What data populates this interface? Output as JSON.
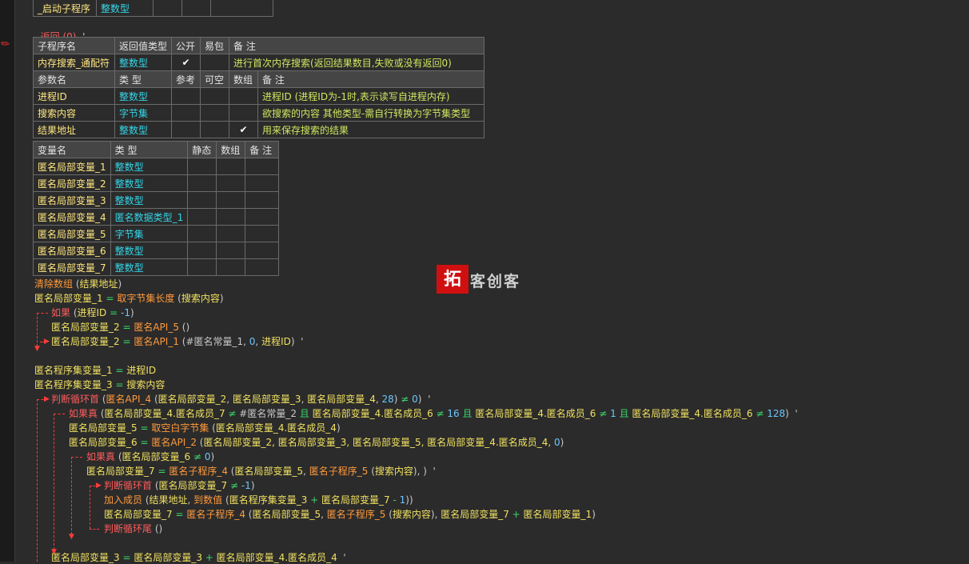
{
  "prev_table": {
    "name": "_启动子程序",
    "type": "整数型"
  },
  "return_line": {
    "text": "返回 (0)",
    "tail": "'"
  },
  "sub_headers": [
    "子程序名",
    "返回值类型",
    "公开",
    "易包",
    "备 注"
  ],
  "sub_row": {
    "name": "内存搜索_通配符",
    "type": "整数型",
    "public": "✔",
    "easy": "",
    "note": "进行首次内存搜索(返回结果数目,失败或没有返回0)"
  },
  "param_headers": [
    "参数名",
    "类 型",
    "参考",
    "可空",
    "数组",
    "备 注"
  ],
  "params": [
    {
      "name": "进程ID",
      "type": "整数型",
      "ref": "",
      "nullable": "",
      "array": "",
      "note": "进程ID (进程ID为-1时,表示读写自进程内存)"
    },
    {
      "name": "搜索内容",
      "type": "字节集",
      "ref": "",
      "nullable": "",
      "array": "",
      "note": "欲搜索的内容  其他类型-需自行转换为字节集类型"
    },
    {
      "name": "结果地址",
      "type": "整数型",
      "ref": "",
      "nullable": "",
      "array": "✔",
      "note": "用来保存搜索的结果"
    }
  ],
  "var_headers": [
    "变量名",
    "类 型",
    "静态",
    "数组",
    "备 注"
  ],
  "vars": [
    {
      "name": "匿名局部变量_1",
      "type": "整数型"
    },
    {
      "name": "匿名局部变量_2",
      "type": "整数型"
    },
    {
      "name": "匿名局部变量_3",
      "type": "整数型"
    },
    {
      "name": "匿名局部变量_4",
      "type": "匿名数据类型_1"
    },
    {
      "name": "匿名局部变量_5",
      "type": "字节集"
    },
    {
      "name": "匿名局部变量_6",
      "type": "整数型"
    },
    {
      "name": "匿名局部变量_7",
      "type": "整数型"
    }
  ],
  "logo": {
    "mark": "拓",
    "text": "客创客"
  },
  "code": {
    "l1": {
      "fn": "清除数组",
      "a": " (",
      "arg": "结果地址",
      "b": ")"
    },
    "l2": {
      "v": "匿名局部变量_1",
      "eq": " = ",
      "fn": "取字节集长度",
      "a": " (",
      "arg": "搜索内容",
      "b": ")"
    },
    "l3": {
      "kw": "如果",
      "a": " (",
      "v": "进程ID",
      "eq": " = ",
      "num": "-1",
      "b": ")"
    },
    "l4": {
      "v": "匿名局部变量_2",
      "eq": " = ",
      "fn": "匿名API_5",
      "b": " ()"
    },
    "l5": {
      "v": "匿名局部变量_2",
      "eq": " = ",
      "fn": "匿名API_1",
      "a": " (#匿名常量_1, ",
      "num": "0",
      "c": ", ",
      "v2": "进程ID",
      "b": ")  ",
      "tk": "'"
    },
    "l6": {
      "v": "匿名程序集变量_1",
      "eq": " = ",
      "v2": "进程ID"
    },
    "l7": {
      "v": "匿名程序集变量_3",
      "eq": " = ",
      "v2": "搜索内容"
    },
    "l8": {
      "kw": "判断循环首",
      "a": " (",
      "fn": "匿名API_4",
      "b": " (",
      "v1": "匿名局部变量_2",
      "c1": ", ",
      "v2": "匿名局部变量_3",
      "c2": ", ",
      "v3": "匿名局部变量_4",
      "c3": ", ",
      "num": "28",
      "d": ") ",
      "op": "≠",
      "num2": " 0",
      "e": ")  ",
      "tk": "'"
    },
    "l9": {
      "kw": "如果真",
      "a": " (",
      "v1": "匿名局部变量_4.匿名成员_7",
      "op1": " ≠ ",
      "c1": "#匿名常量_2",
      "k1": " 且 ",
      "v2": "匿名局部变量_4.匿名成员_6",
      "op2": " ≠ ",
      "n2": "16",
      "k2": " 且 ",
      "v3": "匿名局部变量_4.匿名成员_6",
      "op3": " ≠ ",
      "n3": "1",
      "k3": " 且 ",
      "v4": "匿名局部变量_4.匿名成员_6",
      "op4": " ≠ ",
      "n4": "128",
      "e": ")  ",
      "tk": "'"
    },
    "l10": {
      "v": "匿名局部变量_5",
      "eq": " = ",
      "fn": "取空白字节集",
      "a": " (",
      "arg": "匿名局部变量_4.匿名成员_4",
      "b": ")"
    },
    "l11": {
      "v": "匿名局部变量_6",
      "eq": " = ",
      "fn": "匿名API_2",
      "a": " (",
      "args": "匿名局部变量_2, 匿名局部变量_3, 匿名局部变量_5, 匿名局部变量_4.匿名成员_4, ",
      "num": "0",
      "b": ")"
    },
    "l12": {
      "kw": "如果真",
      "a": " (",
      "v": "匿名局部变量_6",
      "op": " ≠ ",
      "num": "0",
      "b": ")"
    },
    "l13": {
      "v": "匿名局部变量_7",
      "eq": " = ",
      "fn": "匿名子程序_4",
      "a": " (",
      "v2": "匿名局部变量_5",
      "c": ", ",
      "fn2": "匿名子程序_5",
      "b": " (",
      "arg": "搜索内容",
      "d": "), )  ",
      "tk": "'"
    },
    "l14": {
      "kw": "判断循环首",
      "a": " (",
      "v": "匿名局部变量_7",
      "op": " ≠ ",
      "num": "-1",
      "b": ")"
    },
    "l15": {
      "fn": "加入成员",
      "a": " (",
      "v1": "结果地址",
      "c": ", ",
      "fn2": "到数值",
      "b": " (",
      "v2": "匿名程序集变量_3",
      "op1": " + ",
      "v3": "匿名局部变量_7",
      "op2": " - ",
      "num": "1",
      "d": "))"
    },
    "l16": {
      "v": "匿名局部变量_7",
      "eq": " = ",
      "fn": "匿名子程序_4",
      "a": " (",
      "v2": "匿名局部变量_5",
      "c": ", ",
      "fn2": "匿名子程序_5",
      "b": " (",
      "arg": "搜索内容",
      "d": "), ",
      "v3": "匿名局部变量_7",
      "op": " + ",
      "v4": "匿名局部变量_1",
      "e": ")"
    },
    "l17": {
      "kw": "判断循环尾",
      "b": " ()"
    },
    "l18": {
      "v": "匿名局部变量_3",
      "eq": " = ",
      "v2": "匿名局部变量_3",
      "op": " + ",
      "v3": "匿名局部变量_4.匿名成员_4",
      "e": "  ",
      "tk": "'"
    }
  }
}
